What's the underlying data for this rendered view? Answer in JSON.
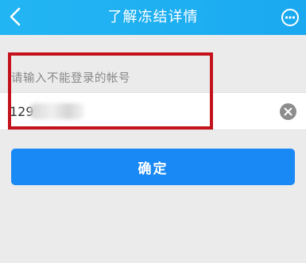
{
  "header": {
    "title": "了解冻结详情",
    "back_icon": "chevron-left-icon",
    "more_icon": "more-dots-icon",
    "background": "#1fb0f2"
  },
  "form": {
    "label": "请输入不能登录的帐号",
    "account_value": "129",
    "clear_icon": "clear-x-icon"
  },
  "confirm": {
    "label": "确定",
    "color": "#1989f6"
  },
  "annotation": {
    "color": "#c4121c"
  }
}
